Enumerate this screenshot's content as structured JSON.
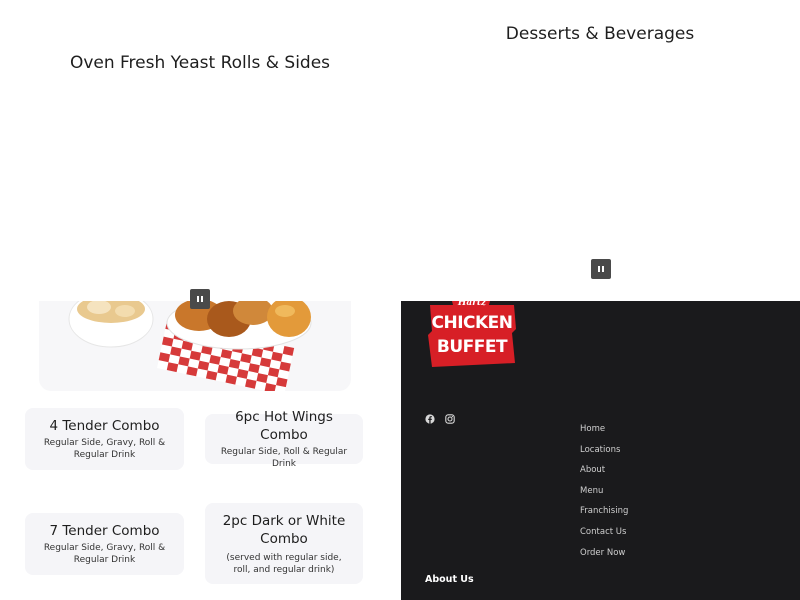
{
  "sections": {
    "rolls_title": "Oven Fresh Yeast Rolls & Sides",
    "desserts_title": "Desserts & Beverages"
  },
  "combos": [
    {
      "title": "4 Tender Combo",
      "subtitle": "Regular Side, Gravy, Roll & Regular Drink"
    },
    {
      "title": "6pc Hot Wings Combo",
      "subtitle": "Regular Side, Roll & Regular Drink"
    },
    {
      "title": "7 Tender Combo",
      "subtitle": "Regular Side, Gravy, Roll & Regular Drink"
    },
    {
      "title": "2pc Dark or White Combo",
      "subtitle": "(served with regular side, roll, and regular drink)"
    }
  ],
  "logo": {
    "brand_small": "Hartz",
    "brand_line1": "CHICKEN",
    "brand_line2": "BUFFET",
    "colors": {
      "red": "#d71f26",
      "white": "#ffffff"
    }
  },
  "social": [
    "facebook-icon",
    "instagram-icon"
  ],
  "footer_nav": [
    "Home",
    "Locations",
    "About",
    "Menu",
    "Franchising",
    "Contact Us",
    "Order Now"
  ],
  "footer_heading": "About Us",
  "colors": {
    "footer_bg": "#1a1a1c",
    "card_bg": "#f5f5f8",
    "pause_bg": "#4a4a4a"
  }
}
